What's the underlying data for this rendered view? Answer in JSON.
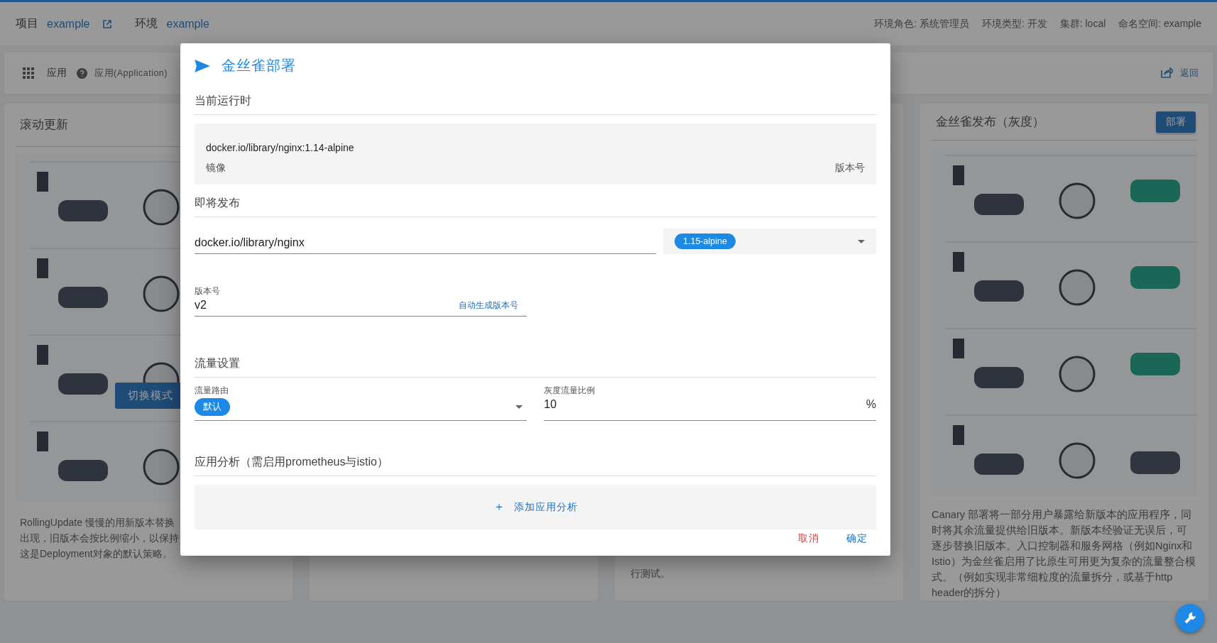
{
  "top_bar": {
    "project_label": "项目",
    "project": "example",
    "env_label": "环境",
    "env": "example",
    "meta": [
      "环境角色: 系统管理员",
      "环境类型: 开发",
      "集群: local",
      "命名空间: example"
    ]
  },
  "app_bar": {
    "title": "应用",
    "help_text": "应用(Application)",
    "back": "返回"
  },
  "cards": [
    {
      "kind": "diagram",
      "title": "滚动更新",
      "overlay_button": "切换模式",
      "description_lines": [
        "RollingUpdate 慢慢的用新版本替换",
        "出现，旧版本会按比例缩小，以保持",
        "这是Deployment对象的默认策略。"
      ]
    },
    {
      "kind": "blank"
    },
    {
      "kind": "blank",
      "description_lines": [
        "行测试。"
      ]
    },
    {
      "kind": "diagram",
      "title": "金丝雀发布（灰度）",
      "button": "部署",
      "description": "Canary 部署将一部分用户暴露给新版本的应用程序，同时将其余流量提供给旧版本。新版本经验证无误后，可逐步替换旧版本。入口控制器和服务网格（例如Nginx和Istio）为金丝雀启用了比原生可用更为复杂的流量整合模式。（例如实现非常细粒度的流量拆分，或基于http header的拆分）"
    }
  ],
  "dialog": {
    "title": "金丝雀部署",
    "current": {
      "heading": "当前运行时",
      "image": "docker.io/library/nginx:1.14-alpine",
      "image_label": "镜像",
      "version_label": "版本号"
    },
    "upcoming": {
      "heading": "即将发布",
      "image_value": "docker.io/library/nginx",
      "tag": "1.15-alpine",
      "version_label": "版本号",
      "version_value": "v2",
      "auto_link": "自动生成版本号"
    },
    "traffic": {
      "heading": "流量设置",
      "route_label": "流量路由",
      "route": "默认",
      "ratio_label": "灰度流量比例",
      "ratio_value": "10",
      "ratio_suffix": "%"
    },
    "analysis": {
      "heading": "应用分析（需启用prometheus与istio）",
      "add_button": "添加应用分析",
      "add_icon": "＋"
    },
    "buttons": [
      {
        "label": "取消",
        "kind": "cancel"
      },
      {
        "label": "确定",
        "kind": "confirm"
      }
    ]
  }
}
